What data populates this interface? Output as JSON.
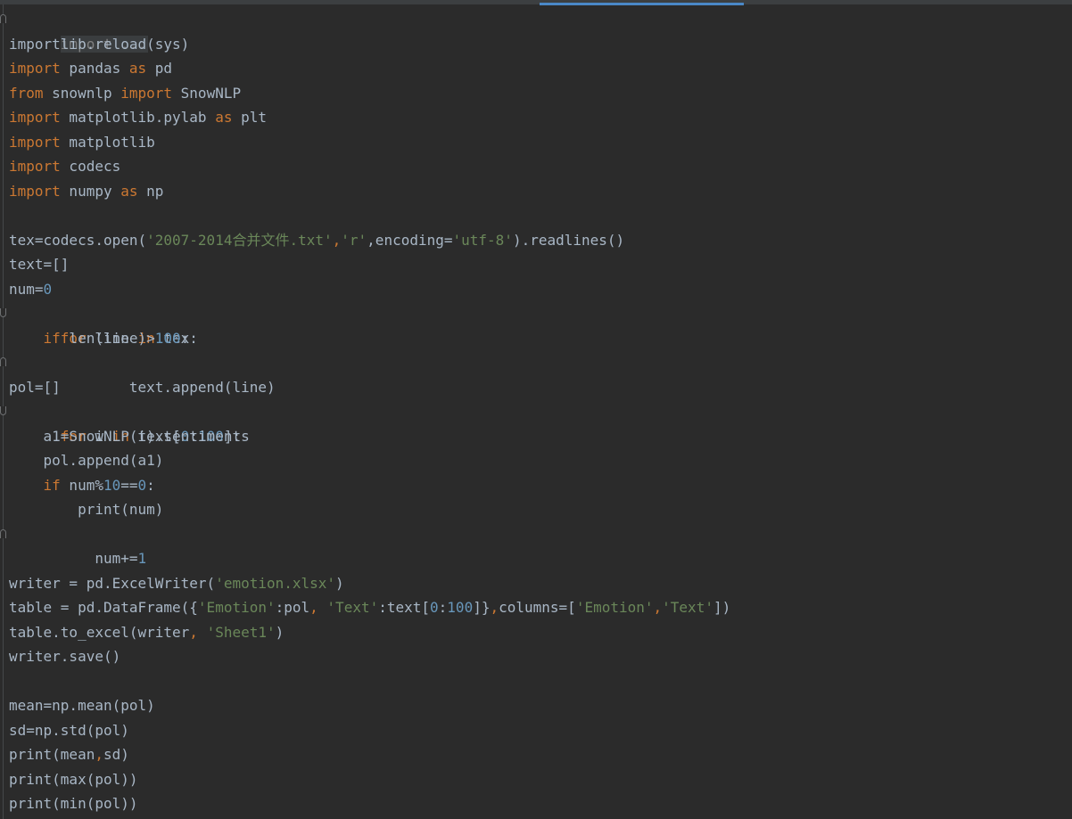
{
  "editor": {
    "colors": {
      "background": "#2b2b2b",
      "default_text": "#a9b7c6",
      "keyword": "#cc7832",
      "string": "#6a8759",
      "number": "#6897bb",
      "folded": "#808080",
      "tab_accent": "#4a88c7"
    },
    "folded_header": "import ...",
    "lines": {
      "l2": "importlib.reload(sys)",
      "l3": [
        "import",
        " pandas ",
        "as",
        " pd"
      ],
      "l4": [
        "from",
        " snownlp ",
        "import",
        " SnowNLP"
      ],
      "l5": [
        "import",
        " matplotlib.pylab ",
        "as",
        " plt"
      ],
      "l6": [
        "import",
        " matplotlib"
      ],
      "l7": [
        "import",
        " codecs"
      ],
      "l8": [
        "import",
        " numpy ",
        "as",
        " np"
      ],
      "l10": [
        "tex=codecs.open(",
        "'2007-2014合并文件.txt'",
        ",",
        "'r'",
        ",encoding=",
        "'utf-8'",
        ").readlines()"
      ],
      "l11": "text=[]",
      "l12": [
        "num=",
        "0"
      ],
      "l13": [
        "for",
        " line ",
        "in",
        " tex:"
      ],
      "l14": [
        "    ",
        "if",
        " len(line)>",
        "100",
        ":"
      ],
      "l15": "        text.append(line)",
      "l16": "pol=[]",
      "l17": [
        "for",
        " i ",
        "in",
        " text[",
        "0",
        ":",
        "100",
        "]:"
      ],
      "l18": "    a1=SnowNLP(i).sentiments",
      "l19": "    pol.append(a1)",
      "l20": [
        "    ",
        "if",
        " num%",
        "10",
        "==",
        "0",
        ":"
      ],
      "l21": "        print(num)",
      "l22": [
        "    num+=",
        "1"
      ],
      "l24": [
        "writer = pd.ExcelWriter(",
        "'emotion.xlsx'",
        ")"
      ],
      "l25": [
        "table = pd.DataFrame({",
        "'Emotion'",
        ":pol",
        ", ",
        "'Text'",
        ":text[",
        "0",
        ":",
        "100",
        "]}",
        ",",
        "columns=[",
        "'Emotion'",
        ",",
        "'Text'",
        "])"
      ],
      "l26": [
        "table.to_excel(writer",
        ", ",
        "'Sheet1'",
        ")"
      ],
      "l27": "writer.save()",
      "l29": "mean=np.mean(pol)",
      "l30": "sd=np.std(pol)",
      "l31": [
        "print(mean",
        ",",
        "sd)"
      ],
      "l32": "print(max(pol))",
      "l33": "print(min(pol))"
    }
  }
}
